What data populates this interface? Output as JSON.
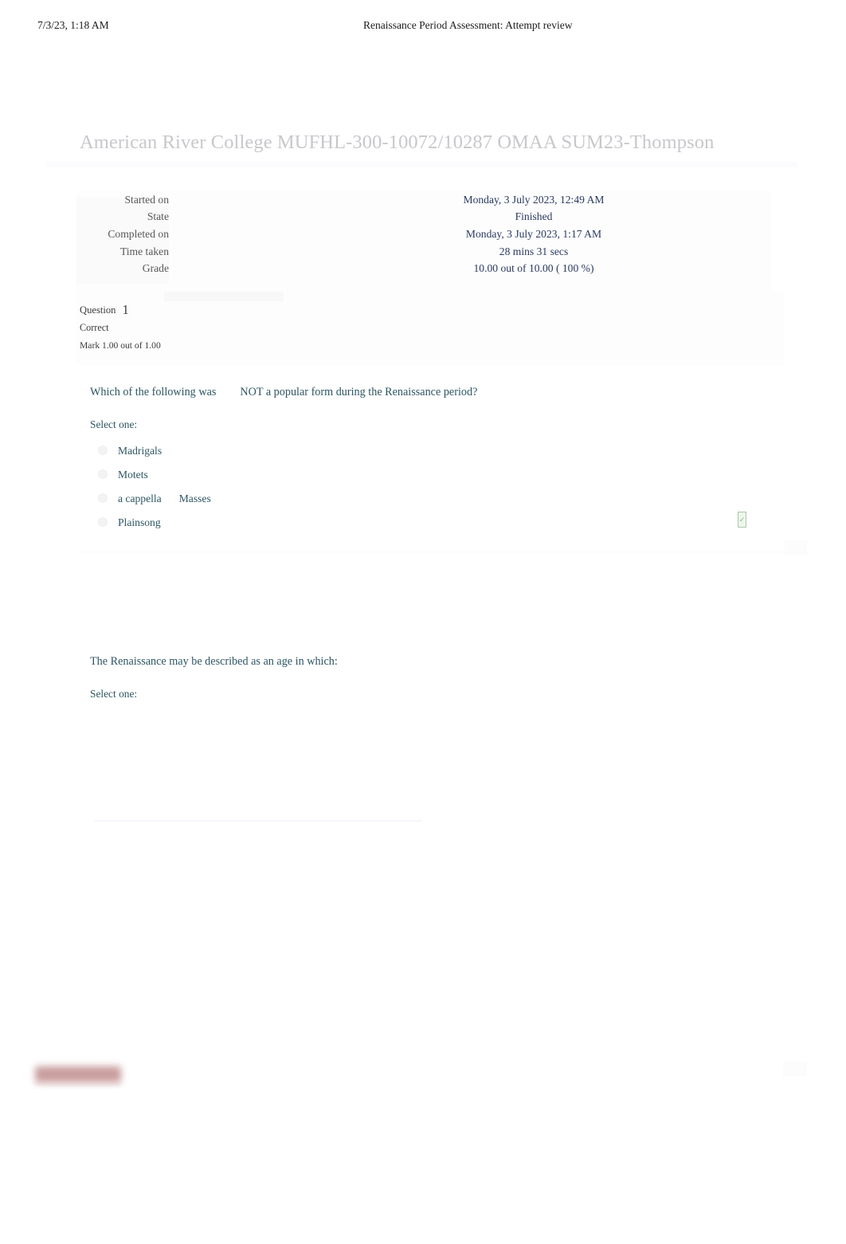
{
  "print_header": {
    "date": "7/3/23, 1:18 AM",
    "title": "Renaissance Period Assessment: Attempt review"
  },
  "page_title": "American River College MUFHL-300-10072/10287 OMAA SUM23-Thompson",
  "summary": {
    "rows": [
      {
        "key": "Started on",
        "value": "Monday, 3 July 2023, 12:49 AM"
      },
      {
        "key": "State",
        "value": "Finished"
      },
      {
        "key": "Completed on",
        "value": "Monday, 3 July 2023, 1:17 AM"
      },
      {
        "key": "Time taken",
        "value": "28 mins 31 secs"
      },
      {
        "key": "Grade",
        "value": "10.00  out of 10.00 (   100 %)"
      }
    ]
  },
  "question1": {
    "label": "Question",
    "number": "1",
    "state": "Correct",
    "mark": "Mark 1.00 out of 1.00",
    "text_part1": "Which of the following was",
    "text_part2": "NOT a popular form during the Renaissance period?",
    "select_one": "Select one:",
    "answers": [
      {
        "label": "Madrigals",
        "label2": "",
        "selected": false,
        "correct_mark": false
      },
      {
        "label": "Motets",
        "label2": "",
        "selected": false,
        "correct_mark": false
      },
      {
        "label": "a cappella",
        "label2": "Masses",
        "selected": false,
        "correct_mark": false
      },
      {
        "label": "Plainsong",
        "label2": "",
        "selected": true,
        "correct_mark": true
      }
    ],
    "correct_glyph": "✓"
  },
  "question2": {
    "text": "The Renaissance may be described as an age in which:",
    "select_one": "Select one:"
  },
  "colors": {
    "question_text": "#2d5663",
    "summary_value": "#2a3a5e",
    "summary_key": "#585858",
    "page_title": "#c8c8cc",
    "correct_accent": "#a9c9a6",
    "redacted": "#c08d8d"
  }
}
